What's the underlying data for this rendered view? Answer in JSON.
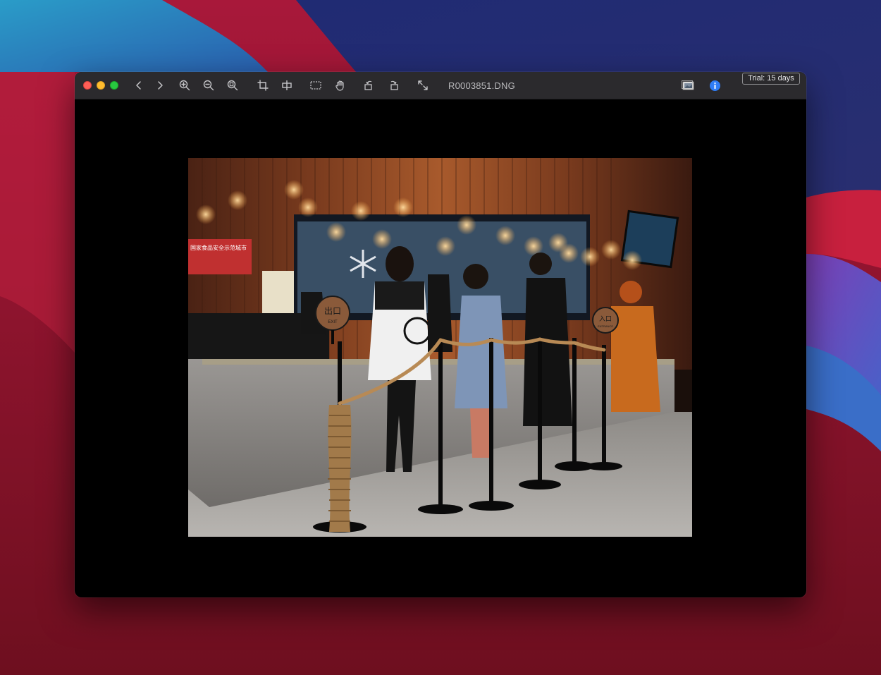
{
  "toolbar": {
    "nav": [
      "chevron-left-icon",
      "chevron-right-icon"
    ],
    "zoom": [
      "zoom-in-icon",
      "zoom-out-icon",
      "zoom-fit-icon"
    ],
    "tools": [
      "crop-icon",
      "align-icon",
      "select-rect-icon",
      "hand-icon"
    ],
    "rotate": [
      "rotate-left-icon",
      "rotate-right-icon"
    ],
    "fullscreen_icon": "expand-icon",
    "document_title": "R0003851.DNG",
    "right_icons": [
      "image-info-icon",
      "info-circle-icon"
    ],
    "trial_label": "Trial: 15 days"
  },
  "photo": {
    "signs": {
      "exit_top": "出口",
      "exit_bottom": "EXIT",
      "entrance_top": "入口",
      "entrance_bottom": "ENTRANCE",
      "banner": "国家食品安全示范城市"
    }
  },
  "colors": {
    "window_bg": "#000000",
    "titlebar_bg": "#2b2a2d",
    "info_blue": "#2f7df6"
  }
}
